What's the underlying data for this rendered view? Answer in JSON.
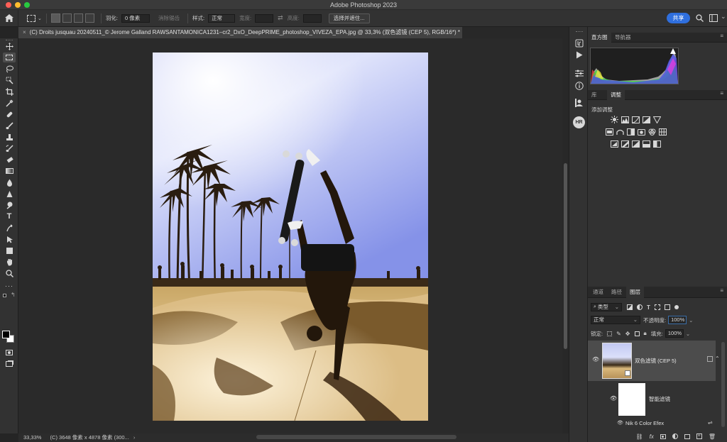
{
  "app": {
    "title": "Adobe Photoshop 2023"
  },
  "options": {
    "feather_label": "羽化:",
    "feather_value": "0 像素",
    "antialias_label": "消除锯齿",
    "style_label": "样式:",
    "style_value": "正常",
    "width_label": "宽度:",
    "height_label": "高度:",
    "select_mask_label": "选择并遮住...",
    "share_label": "共享"
  },
  "document": {
    "tab_title": "(C) Droits jusquau 20240511_© Jerome Galland RAWSANTAMONICA1231–cr2_DxO_DeepPRIME_photoshop_VIVEZA_EPA.jpg @ 33,3% (双色滤镜 (CEP 5), RGB/16*) *",
    "close_glyph": "×"
  },
  "status": {
    "zoom": "33,33%",
    "info": "(C) 3648 像素 x 4878 像素 (300..."
  },
  "panels": {
    "histogram_tabs": [
      "直方图",
      "导航器"
    ],
    "adjust_tabs": [
      "库",
      "调整"
    ],
    "adjust_title": "添加调整",
    "layers_tabs": [
      "通道",
      "路径",
      "图层"
    ],
    "filter_kind": "类型",
    "blend_mode": "正常",
    "opacity_label": "不透明度:",
    "opacity_value": "100%",
    "lock_label": "锁定:",
    "fill_label": "填充:",
    "fill_value": "100%",
    "layers": [
      {
        "name": "双色滤镜 (CEP 5)"
      },
      {
        "name": "智能滤镜"
      },
      {
        "name": "Nik 6 Color Efex"
      }
    ],
    "bottom_fx": "fx"
  },
  "colors": {
    "accent": "#2f6fde",
    "panel_bg": "#323232",
    "canvas_bg": "#2a2a2a",
    "selected_layer": "#4c4c4c"
  },
  "icons": {
    "toolbar": [
      "move-icon",
      "marquee-icon",
      "lasso-icon",
      "quick-select-icon",
      "crop-icon",
      "eyedropper-icon",
      "spot-heal-icon",
      "brush-icon",
      "stamp-icon",
      "history-brush-icon",
      "eraser-icon",
      "gradient-icon",
      "blur-icon",
      "dodge-icon",
      "pen-icon",
      "type-icon",
      "path-select-icon",
      "shape-icon",
      "hand-icon",
      "zoom-icon",
      "more-tools-icon"
    ]
  }
}
